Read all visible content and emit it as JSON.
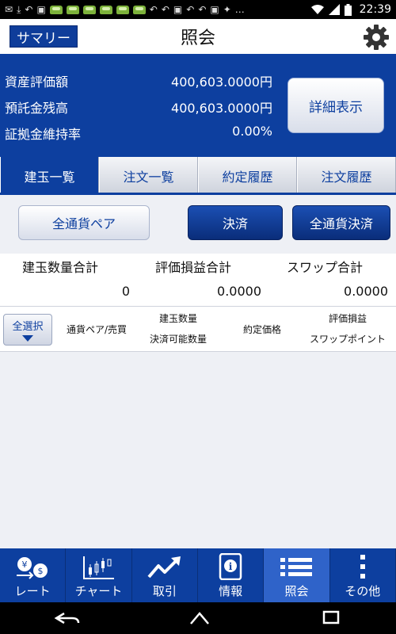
{
  "status_bar": {
    "time": "22:39"
  },
  "title_bar": {
    "summary_label": "サマリー",
    "title": "照会"
  },
  "summary": {
    "rows": [
      {
        "label": "資産評価額",
        "value": "400,603.0000円"
      },
      {
        "label": "預託金残高",
        "value": "400,603.0000円"
      },
      {
        "label": "証拠金維持率",
        "value": "0.00%"
      }
    ],
    "detail_button": "詳細表示"
  },
  "tabs": [
    {
      "label": "建玉一覧",
      "active": true
    },
    {
      "label": "注文一覧",
      "active": false
    },
    {
      "label": "約定履歴",
      "active": false
    },
    {
      "label": "注文履歴",
      "active": false
    }
  ],
  "actions": {
    "currency_pair": "全通貨ペア",
    "settle": "決済",
    "settle_all": "全通貨決済"
  },
  "totals": {
    "headers": [
      "建玉数量合計",
      "評価損益合計",
      "スワップ合計"
    ],
    "values": [
      "0",
      "0.0000",
      "0.0000"
    ]
  },
  "list_header": {
    "select_all": "全選択",
    "col_pair": "通貨ペア/売買",
    "col_qty_top": "建玉数量",
    "col_qty_bottom": "決済可能数量",
    "col_price": "約定価格",
    "col_pl_top": "評価損益",
    "col_pl_bottom": "スワップポイント"
  },
  "bottom_nav": [
    {
      "label": "レート",
      "icon": "rate-icon",
      "active": false
    },
    {
      "label": "チャート",
      "icon": "chart-icon",
      "active": false
    },
    {
      "label": "取引",
      "icon": "trade-icon",
      "active": false
    },
    {
      "label": "情報",
      "icon": "info-icon",
      "active": false
    },
    {
      "label": "照会",
      "icon": "list-icon",
      "active": true
    },
    {
      "label": "その他",
      "icon": "more-icon",
      "active": false
    }
  ],
  "colors": {
    "brand_blue": "#0d3f9f",
    "active_nav": "#2f63c9"
  }
}
